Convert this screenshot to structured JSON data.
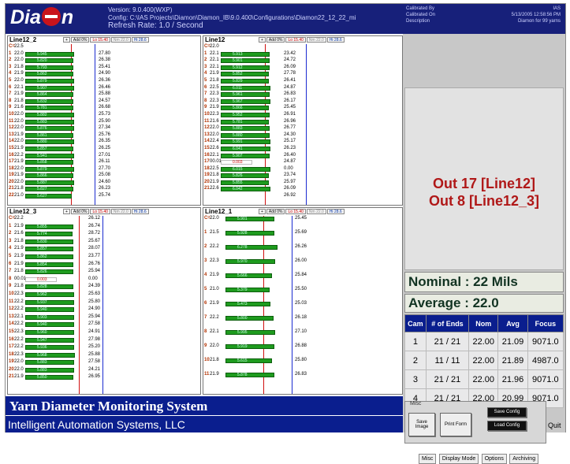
{
  "header": {
    "logo": "DiaMon",
    "version": "Version: 9.0.400(WXP)",
    "config": "Config: C:\\IAS Projects\\Diamon\\Diamon_IB\\9.0.400\\Configurations\\Diamon22_12_22_mi",
    "refresh": "Refresh Rate: 1.0 / Second"
  },
  "meta": {
    "calibrated_by_label": "Calibrated By",
    "calibrated_on_label": "Calibrated On",
    "description_label": "Description",
    "calibrated_by": "IAS",
    "calibrated_on": "5/13/2005 12:58:56 PM",
    "description": "Diamon for 99 yarns"
  },
  "panel_buttons": {
    "plus": "+",
    "add": "Add 0%",
    "lo": "Lo 15.40",
    "nm": "Nm 22.0",
    "hi": "Hi 28.6"
  },
  "panels": [
    {
      "title": "Line12_2",
      "rows": [
        {
          "i": "C=",
          "v": "22.5",
          "p": "",
          "t": ""
        },
        {
          "i": "1",
          "v": "22.0",
          "p": "5.945",
          "t": "27.80"
        },
        {
          "i": "2",
          "v": "22.0",
          "p": "5.820",
          "t": "26.38"
        },
        {
          "i": "3",
          "v": "21.8",
          "p": "5.793",
          "t": "25.41"
        },
        {
          "i": "4",
          "v": "21.9",
          "p": "5.862",
          "t": "24.90"
        },
        {
          "i": "5",
          "v": "22.0",
          "p": "5.879",
          "t": "26.36"
        },
        {
          "i": "6",
          "v": "22.1",
          "p": "5.907",
          "t": "26.46"
        },
        {
          "i": "7",
          "v": "21.9",
          "p": "5.864",
          "t": "25.88"
        },
        {
          "i": "8",
          "v": "21.8",
          "p": "5.832",
          "t": "24.57"
        },
        {
          "i": "9",
          "v": "21.6",
          "p": "5.781",
          "t": "26.68"
        },
        {
          "i": "10",
          "v": "22.0",
          "p": "5.882",
          "t": "25.73"
        },
        {
          "i": "11",
          "v": "22.0",
          "p": "5.883",
          "t": "25.90"
        },
        {
          "i": "12",
          "v": "22.0",
          "p": "5.876",
          "t": "27.34"
        },
        {
          "i": "13",
          "v": "21.9",
          "p": "5.861",
          "t": "25.76"
        },
        {
          "i": "14",
          "v": "22.0",
          "p": "5.880",
          "t": "26.35"
        },
        {
          "i": "15",
          "v": "21.9",
          "p": "5.857",
          "t": "26.25"
        },
        {
          "i": "16",
          "v": "22.2",
          "p": "5.941",
          "t": "27.01"
        },
        {
          "i": "17",
          "v": "21.9",
          "p": "5.858",
          "t": "26.11"
        },
        {
          "i": "18",
          "v": "22.0",
          "p": "5.879",
          "t": "27.70"
        },
        {
          "i": "19",
          "v": "21.9",
          "p": "5.866",
          "t": "25.08"
        },
        {
          "i": "20",
          "v": "22.0",
          "p": "5.887",
          "t": "24.60"
        },
        {
          "i": "21",
          "v": "21.8",
          "p": "5.827",
          "t": "26.23"
        },
        {
          "i": "22",
          "v": "21.0",
          "p": "5.627",
          "t": "25.74"
        }
      ]
    },
    {
      "title": "Line12",
      "rows": [
        {
          "i": "C=",
          "v": "22.0",
          "p": "",
          "t": ""
        },
        {
          "i": "1",
          "v": "22.1",
          "p": "5.913",
          "t": "23.42"
        },
        {
          "i": "2",
          "v": "22.1",
          "p": "5.901",
          "t": "24.72"
        },
        {
          "i": "3",
          "v": "22.1",
          "p": "5.912",
          "t": "26.09"
        },
        {
          "i": "4",
          "v": "21.9",
          "p": "5.852",
          "t": "27.78"
        },
        {
          "i": "5",
          "v": "21.8",
          "p": "5.829",
          "t": "26.41"
        },
        {
          "i": "6",
          "v": "22.5",
          "p": "6.011",
          "t": "24.87"
        },
        {
          "i": "7",
          "v": "22.3",
          "p": "5.961",
          "t": "26.83"
        },
        {
          "i": "8",
          "v": "22.3",
          "p": "5.967",
          "t": "26.17"
        },
        {
          "i": "9",
          "v": "21.9",
          "p": "5.866",
          "t": "25.45"
        },
        {
          "i": "10",
          "v": "22.3",
          "p": "5.952",
          "t": "26.91"
        },
        {
          "i": "11",
          "v": "21.6",
          "p": "5.781",
          "t": "26.96"
        },
        {
          "i": "12",
          "v": "22.0",
          "p": "5.883",
          "t": "26.77"
        },
        {
          "i": "13",
          "v": "22.0",
          "p": "5.880",
          "t": "24.30"
        },
        {
          "i": "14",
          "v": "22.4",
          "p": "5.991",
          "t": "25.17"
        },
        {
          "i": "15",
          "v": "22.6",
          "p": "6.041",
          "t": "26.23"
        },
        {
          "i": "16",
          "v": "22.1",
          "p": "5.907",
          "t": "26.40"
        },
        {
          "i": "17",
          "v": "00.01",
          "p": "0.003",
          "t": "24.87"
        },
        {
          "i": "18",
          "v": "22.5",
          "p": "6.015",
          "t": "0.00"
        },
        {
          "i": "19",
          "v": "21.8",
          "p": "5.826",
          "t": "23.74"
        },
        {
          "i": "20",
          "v": "21.9",
          "p": "5.855",
          "t": "25.97"
        },
        {
          "i": "21",
          "v": "22.6",
          "p": "6.042",
          "t": "26.09"
        },
        {
          "i": "",
          "v": "",
          "p": "",
          "t": "26.92"
        }
      ]
    },
    {
      "title": "Line12_3",
      "rows": [
        {
          "i": "C=",
          "v": "22.2",
          "p": "",
          "t": "26.12"
        },
        {
          "i": "1",
          "v": "21.9",
          "p": "5.855",
          "t": "26.74"
        },
        {
          "i": "2",
          "v": "21.6",
          "p": "5.774",
          "t": "28.72"
        },
        {
          "i": "3",
          "v": "21.8",
          "p": "5.830",
          "t": "25.67"
        },
        {
          "i": "4",
          "v": "21.9",
          "p": "5.857",
          "t": "28.07"
        },
        {
          "i": "5",
          "v": "21.9",
          "p": "5.862",
          "t": "23.77"
        },
        {
          "i": "6",
          "v": "21.9",
          "p": "5.854",
          "t": "26.76"
        },
        {
          "i": "7",
          "v": "21.8",
          "p": "5.826",
          "t": "25.94"
        },
        {
          "i": "8",
          "v": "00.01",
          "p": "0.003",
          "t": "0.00"
        },
        {
          "i": "9",
          "v": "21.8",
          "p": "5.828",
          "t": "24.39"
        },
        {
          "i": "10",
          "v": "22.3",
          "p": "5.962",
          "t": "25.63"
        },
        {
          "i": "11",
          "v": "22.2",
          "p": "5.937",
          "t": "25.80"
        },
        {
          "i": "12",
          "v": "22.2",
          "p": "5.940",
          "t": "24.90"
        },
        {
          "i": "13",
          "v": "22.1",
          "p": "5.903",
          "t": "25.94"
        },
        {
          "i": "14",
          "v": "22.2",
          "p": "5.940",
          "t": "27.58"
        },
        {
          "i": "15",
          "v": "22.3",
          "p": "5.960",
          "t": "24.91"
        },
        {
          "i": "16",
          "v": "22.2",
          "p": "5.947",
          "t": "27.98"
        },
        {
          "i": "17",
          "v": "22.2",
          "p": "5.936",
          "t": "25.20"
        },
        {
          "i": "18",
          "v": "22.3",
          "p": "5.968",
          "t": "25.88"
        },
        {
          "i": "19",
          "v": "22.0",
          "p": "5.883",
          "t": "27.58"
        },
        {
          "i": "20",
          "v": "22.0",
          "p": "5.883",
          "t": "24.21"
        },
        {
          "i": "21",
          "v": "21.9",
          "p": "5.850",
          "t": "26.95"
        }
      ]
    },
    {
      "title": "Line12_1",
      "rows": [
        {
          "i": "C=",
          "v": "22.0",
          "p": "5.901",
          "t": "25.45"
        },
        {
          "i": "1",
          "v": "21.5",
          "p": "5.928",
          "t": "25.69"
        },
        {
          "i": "2",
          "v": "22.2",
          "p": "6.278",
          "t": "26.26"
        },
        {
          "i": "3",
          "v": "22.3",
          "p": "5.970",
          "t": "26.00"
        },
        {
          "i": "4",
          "v": "21.9",
          "p": "5.666",
          "t": "25.84"
        },
        {
          "i": "5",
          "v": "21.0",
          "p": "5.379",
          "t": "25.50"
        },
        {
          "i": "6",
          "v": "21.9",
          "p": "5.473",
          "t": "25.03"
        },
        {
          "i": "7",
          "v": "22.2",
          "p": "5.800",
          "t": "26.18"
        },
        {
          "i": "8",
          "v": "22.1",
          "p": "5.995",
          "t": "27.10"
        },
        {
          "i": "9",
          "v": "22.0",
          "p": "5.919",
          "t": "26.88"
        },
        {
          "i": "10",
          "v": "21.8",
          "p": "5.615",
          "t": "25.80"
        },
        {
          "i": "11",
          "v": "21.9",
          "p": "5.878",
          "t": "26.83"
        }
      ]
    }
  ],
  "outputs": [
    "Out 17 [Line12]",
    "Out 8 [Line12_3]"
  ],
  "nominal": "Nominal :  22 Mils",
  "average": "Average : 22.0",
  "cam_table": {
    "headers": [
      "Cam",
      "# of Ends",
      "Nom",
      "Avg",
      "Focus"
    ],
    "rows": [
      [
        "1",
        "21 / 21",
        "22.00",
        "21.09",
        "9071.0"
      ],
      [
        "2",
        "11 / 11",
        "22.00",
        "21.89",
        "4987.0"
      ],
      [
        "3",
        "21 / 21",
        "22.00",
        "21.96",
        "9071.0"
      ],
      [
        "4",
        "21 / 21",
        "22.00",
        "20.99",
        "9071.0"
      ]
    ]
  },
  "misc": {
    "label": "Misc",
    "save_image": "Save Image",
    "print_form": "Print Form",
    "save_config": "Save Config",
    "load_config": "Load Config",
    "quit": "Quit"
  },
  "tabs": [
    "Misc",
    "Display Mode",
    "Options",
    "Archiving"
  ],
  "banner": "Yarn Diameter Monitoring System",
  "footer": "Intelligent Automation Systems, LLC"
}
